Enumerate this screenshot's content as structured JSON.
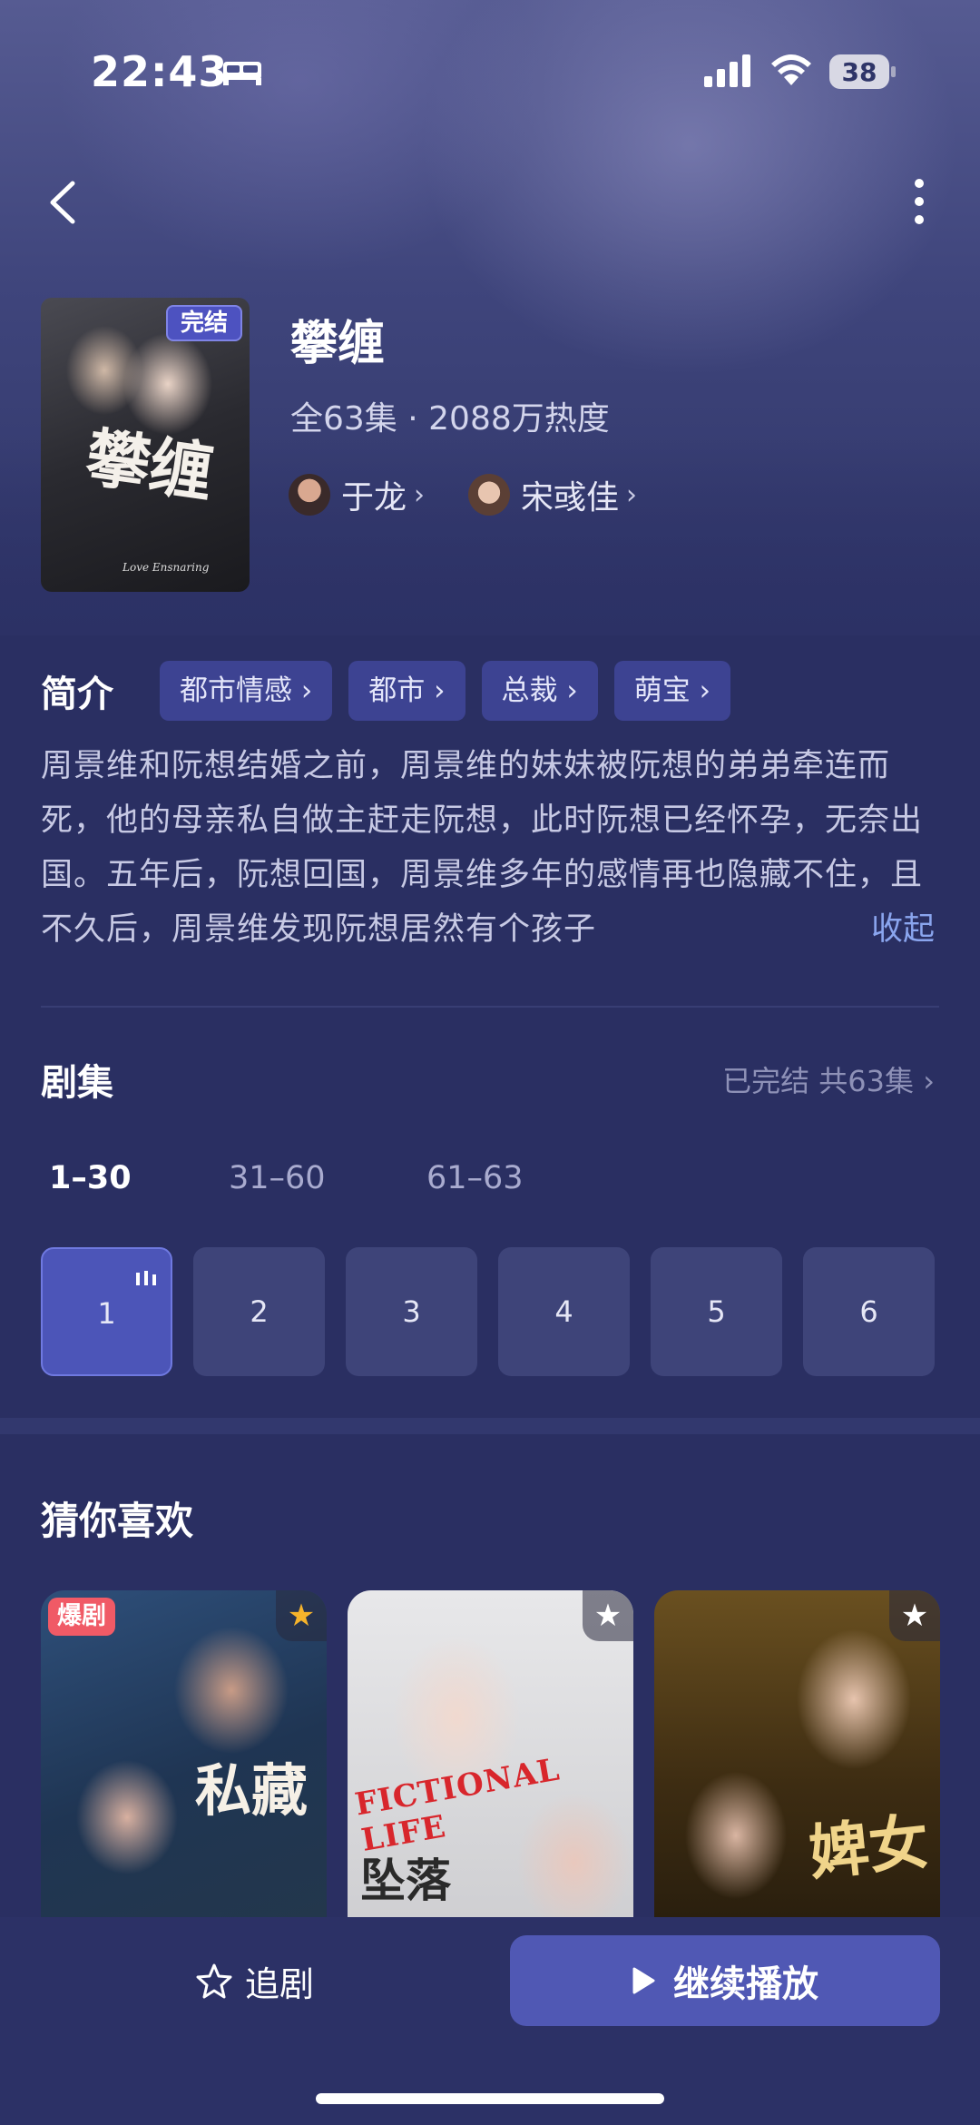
{
  "status_bar": {
    "time": "22:43",
    "battery": "38"
  },
  "drama": {
    "badge": "完结",
    "title": "攀缠",
    "poster_title": "攀缠",
    "poster_subtitle": "Love Ensnaring",
    "meta": "全63集 · 2088万热度",
    "actors": [
      {
        "name": "于龙"
      },
      {
        "name": "宋彧佳"
      }
    ]
  },
  "intro": {
    "label": "简介",
    "tags": [
      "都市情感",
      "都市",
      "总裁",
      "萌宝"
    ],
    "text": "周景维和阮想结婚之前，周景维的妹妹被阮想的弟弟牵连而死，他的母亲私自做主赶走阮想，此时阮想已经怀孕，无奈出国。五年后，阮想回国，周景维多年的感情再也隐藏不住，且不久后，周景维发现阮想居然有个孩子",
    "collapse": "收起"
  },
  "episodes": {
    "label": "剧集",
    "status": "已完结 共63集",
    "ranges": [
      "1–30",
      "31–60",
      "61–63"
    ],
    "items": [
      "1",
      "2",
      "3",
      "4",
      "5",
      "6"
    ]
  },
  "recommend": {
    "label": "猜你喜欢",
    "items": [
      {
        "badge": "爆剧",
        "poster_text": "私藏",
        "star_color": "#f5b32b"
      },
      {
        "poster_text": "FICTIONAL LIFE",
        "poster_text2": "坠落",
        "star_color": "#ffffff"
      },
      {
        "poster_text": "婢女",
        "star_color": "#ffffff"
      }
    ]
  },
  "bottom": {
    "follow_label": "追剧",
    "play_label": "继续播放"
  },
  "colors": {
    "accent": "#5058b4",
    "background": "#2a2f62",
    "tag_bg": "#3d4392",
    "hot_badge": "#f05a66"
  }
}
